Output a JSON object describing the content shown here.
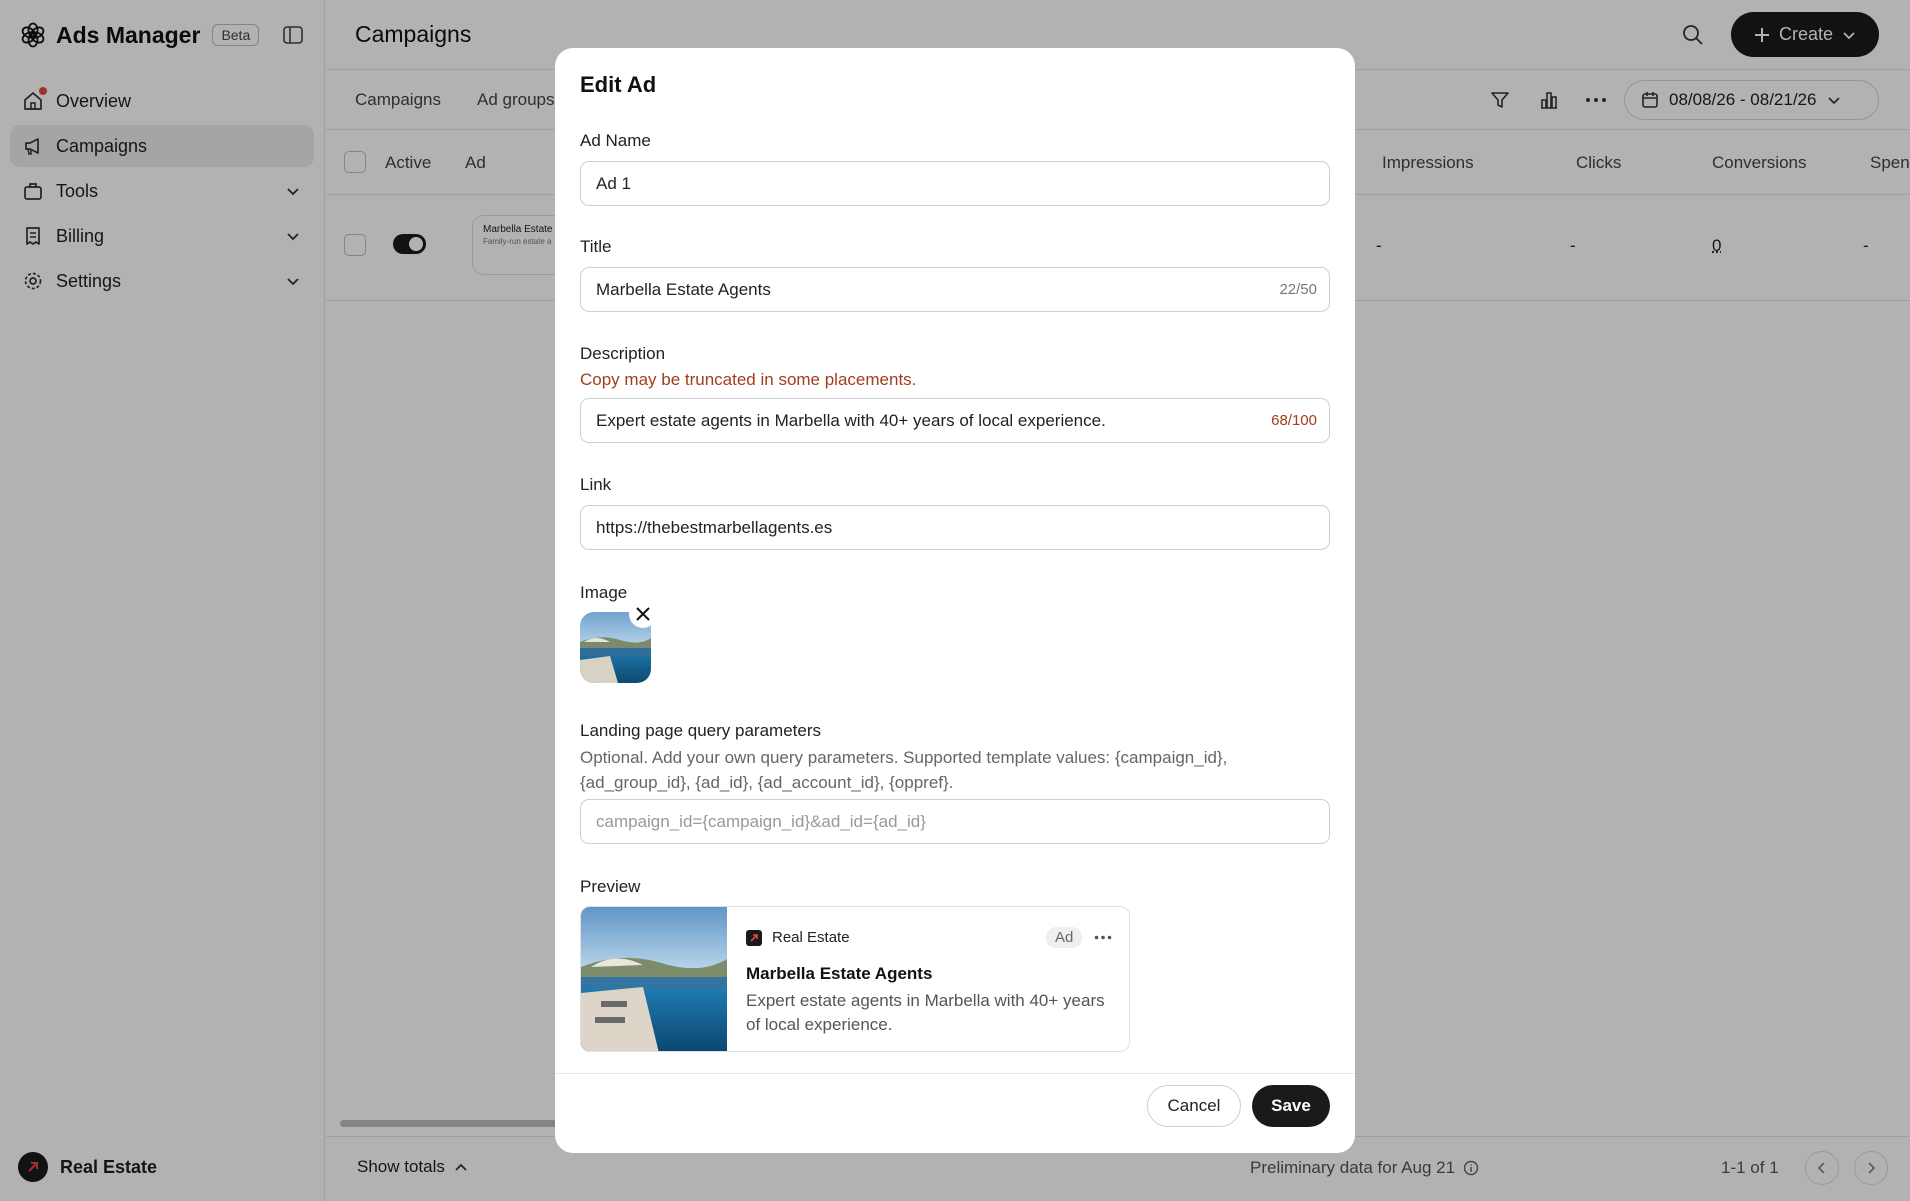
{
  "app": {
    "title": "Ads Manager",
    "badge": "Beta"
  },
  "sidebar": {
    "items": [
      {
        "label": "Overview",
        "icon": "home-icon"
      },
      {
        "label": "Campaigns",
        "icon": "megaphone-icon"
      },
      {
        "label": "Tools",
        "icon": "toolbox-icon"
      },
      {
        "label": "Billing",
        "icon": "receipt-icon"
      },
      {
        "label": "Settings",
        "icon": "gear-icon"
      }
    ],
    "account": "Real Estate"
  },
  "header": {
    "title": "Campaigns",
    "create_label": "Create"
  },
  "tabs": [
    {
      "label": "Campaigns"
    },
    {
      "label": "Ad groups"
    }
  ],
  "date_range": "08/08/26 - 08/21/26",
  "table": {
    "columns": [
      "Active",
      "Ad",
      "Impressions",
      "Clicks",
      "Conversions",
      "Spen"
    ],
    "row": {
      "ad_title": "Marbella Estate",
      "ad_desc": "Family-run estate a",
      "impressions": "-",
      "clicks": "-",
      "conversions": "0",
      "spend": "-"
    }
  },
  "footer": {
    "show_totals": "Show totals",
    "preliminary": "Preliminary data for Aug 21",
    "pagination": "1-1 of 1"
  },
  "modal": {
    "title": "Edit Ad",
    "ad_name": {
      "label": "Ad Name",
      "value": "Ad 1"
    },
    "title_field": {
      "label": "Title",
      "value": "Marbella Estate Agents",
      "count": "22/50"
    },
    "description": {
      "label": "Description",
      "warning": "Copy may be truncated in some placements.",
      "value": "Expert estate agents in Marbella with 40+ years of local experience.",
      "count": "68/100"
    },
    "link": {
      "label": "Link",
      "value": "https://thebestmarbellagents.es"
    },
    "image": {
      "label": "Image"
    },
    "query": {
      "label": "Landing page query parameters",
      "help": "Optional. Add your own query parameters. Supported template values: {campaign_id}, {ad_group_id}, {ad_id}, {ad_account_id}, {oppref}.",
      "placeholder": "campaign_id={campaign_id}&ad_id={ad_id}"
    },
    "preview": {
      "label": "Preview",
      "brand": "Real Estate",
      "ad_badge": "Ad",
      "title": "Marbella Estate Agents",
      "description": "Expert estate agents in Marbella with 40+ years of local experience."
    },
    "cancel_label": "Cancel",
    "save_label": "Save"
  },
  "colors": {
    "accent": "#1a1a1a",
    "warning": "#a33d1c",
    "notification": "#e5483f"
  }
}
